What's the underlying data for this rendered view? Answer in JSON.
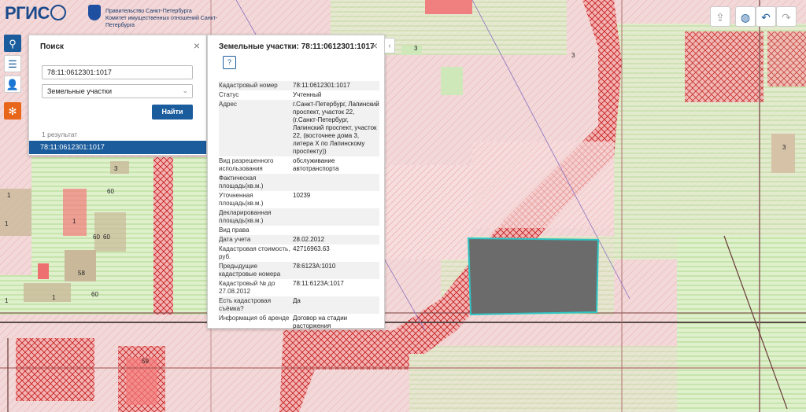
{
  "header": {
    "logo_text": "РГИС",
    "gov_line1": "Правительство Санкт-Петербурга",
    "gov_line2": "Комитет имущественных отношений Санкт-Петербурга"
  },
  "search": {
    "title": "Поиск",
    "query_value": "78:11:0612301:1017",
    "layer_value": "Земельные участки",
    "find_label": "Найти",
    "results_count": "1 результат",
    "results": [
      "78:11:0612301:1017"
    ]
  },
  "info": {
    "title": "Земельные участки: 78:11:0612301:1017",
    "icon_label": "?",
    "rows": [
      {
        "k": "Кадастровый номер",
        "v": "78:11:0612301:1017"
      },
      {
        "k": "Статус",
        "v": "Учтенный"
      },
      {
        "k": "Адрес",
        "v": "г.Санкт-Петербург, Лапинский проспект, участок 22, (г.Санкт-Петербург, Лапинский проспект, участок 22, (восточнее дома 3, литера Х по Лапинскому проспекту))"
      },
      {
        "k": "Вид разрешенного использования",
        "v": "обслуживание автотранспорта"
      },
      {
        "k": "Фактическая площадь(кв.м.)",
        "v": ""
      },
      {
        "k": "Уточненная площадь(кв.м.)",
        "v": "10239"
      },
      {
        "k": "Декларированная площадь(кв.м.)",
        "v": ""
      },
      {
        "k": "Вид права",
        "v": ""
      },
      {
        "k": "Дата учета",
        "v": "28.02.2012"
      },
      {
        "k": "Кадастровая стоимость, руб.",
        "v": "42716963.63"
      },
      {
        "k": "Предыдущие кадастровые номера",
        "v": "78:6123А:1010"
      },
      {
        "k": "Кадастровый № до 27.08.2012",
        "v": "78:11:6123А:1017"
      },
      {
        "k": "Есть кадастровая съёмка?",
        "v": "Да"
      },
      {
        "k": "Информация об аренде",
        "v": "Договор на стадии расторжения"
      }
    ]
  },
  "map": {
    "labels": [
      "3",
      "3",
      "3",
      "3",
      "1",
      "1",
      "1",
      "60",
      "60",
      "60",
      "60",
      "58",
      "59",
      "1",
      "1"
    ]
  },
  "icons": {
    "search": "search-icon",
    "menu": "menu-icon",
    "user": "user-icon",
    "layers": "layers-icon",
    "share": "share-icon",
    "globe": "globe-icon",
    "undo": "undo-icon",
    "redo": "redo-icon"
  },
  "colors": {
    "accent": "#1b5c9c",
    "parcel_red": "#e03030",
    "selected_parcel": "#6b6b6b",
    "selected_outline": "#2ec4c4"
  }
}
